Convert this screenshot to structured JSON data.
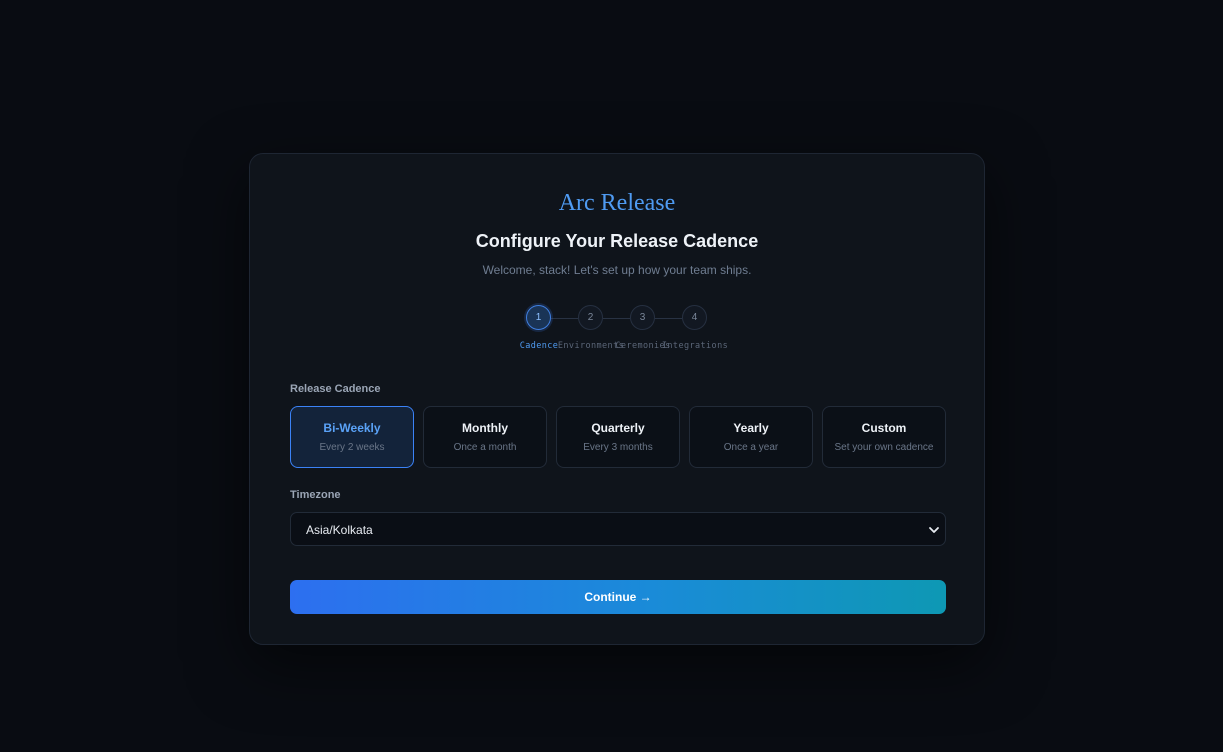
{
  "brand": "Arc Release",
  "title": "Configure Your Release Cadence",
  "subtitle": "Welcome, stack! Let's set up how your team ships.",
  "stepper": {
    "active_step": 1,
    "steps": [
      {
        "number": "1",
        "label": "Cadence"
      },
      {
        "number": "2",
        "label": "Environments"
      },
      {
        "number": "3",
        "label": "Ceremonies"
      },
      {
        "number": "4",
        "label": "Integrations"
      }
    ]
  },
  "cadence": {
    "label": "Release Cadence",
    "selected": "Bi-Weekly",
    "options": [
      {
        "title": "Bi-Weekly",
        "subtitle": "Every 2 weeks"
      },
      {
        "title": "Monthly",
        "subtitle": "Once a month"
      },
      {
        "title": "Quarterly",
        "subtitle": "Every 3 months"
      },
      {
        "title": "Yearly",
        "subtitle": "Once a year"
      },
      {
        "title": "Custom",
        "subtitle": "Set your own cadence"
      }
    ]
  },
  "timezone": {
    "label": "Timezone",
    "value": "Asia/Kolkata"
  },
  "continue_label": "Continue →",
  "icons": {
    "dropdown": "chevron-down-icon"
  },
  "colors": {
    "accent": "#3b82f6",
    "brand_text": "#4f9bf2",
    "background": "#090c12",
    "card": "#0f141b",
    "button_gradient_start": "#2d6ff0",
    "button_gradient_end": "#0e98b4"
  }
}
